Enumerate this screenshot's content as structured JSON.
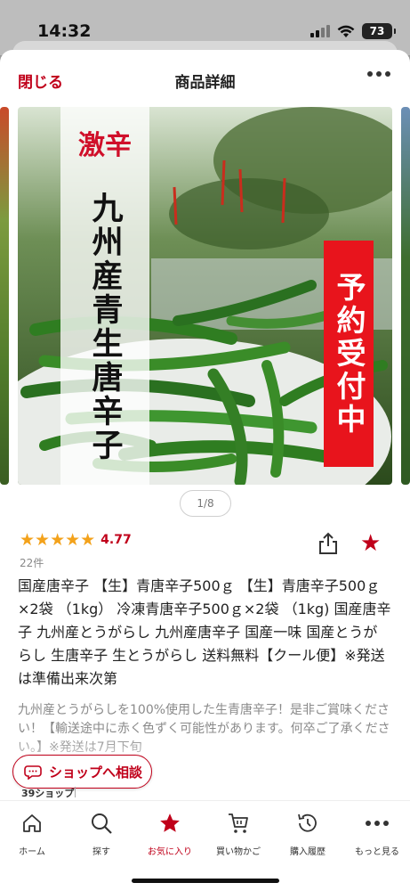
{
  "status_bar": {
    "time": "14:32",
    "battery": "73"
  },
  "header": {
    "close_label": "閉じる",
    "title": "商品詳細",
    "more_icon": "more-horizontal-icon"
  },
  "image": {
    "label_top": "激辛",
    "label_vertical": "九州産青生唐辛子",
    "label_right": "予約受付中",
    "pager": "1/8"
  },
  "rating": {
    "stars": "★★★★★",
    "value": "4.77",
    "count": "22件"
  },
  "product": {
    "title": "国産唐辛子 【生】青唐辛子500ｇ 【生】青唐辛子500ｇ×2袋 （1kg） 冷凍青唐辛子500ｇ×2袋 （1kg) 国産唐辛子 九州産とうがらし 九州産唐辛子 国産一味 国産とうがらし 生唐辛子 生とうがらし 送料無料【クール便】※発送は準備出来次第",
    "description": "九州産とうがらしを100%使用した生青唐辛子！是非ご賞味ください！【輸送途中に赤く色ずく可能性があります。何卒ご了承ください。】※発送は7月下旬"
  },
  "consult": {
    "label": "ショップへ相談"
  },
  "shop": {
    "badge": "39ショップ"
  },
  "nav": {
    "items": [
      {
        "label": "ホーム",
        "icon": "home-icon"
      },
      {
        "label": "探す",
        "icon": "search-icon"
      },
      {
        "label": "お気に入り",
        "icon": "star-icon"
      },
      {
        "label": "買い物かご",
        "icon": "cart-icon"
      },
      {
        "label": "購入履歴",
        "icon": "history-icon"
      },
      {
        "label": "もっと見る",
        "icon": "more-horizontal-icon"
      }
    ]
  },
  "colors": {
    "accent": "#c0001a",
    "star": "#f3a21b",
    "label_red": "#e8141c"
  }
}
